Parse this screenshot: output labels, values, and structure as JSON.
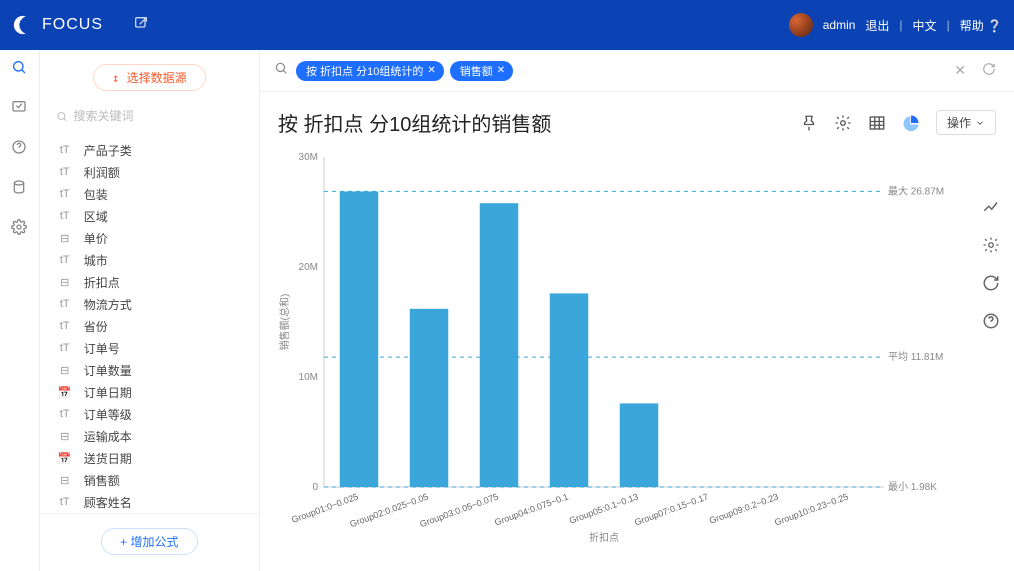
{
  "brand": "FOCUS",
  "top_user": "admin",
  "top_links": {
    "logout": "退出",
    "lang": "中文",
    "help": "帮助"
  },
  "ds_button": "选择数据源",
  "field_search_placeholder": "搜索关键词",
  "add_formula": "增加公式",
  "fields": [
    {
      "type": "tT",
      "label": "产品子类"
    },
    {
      "type": "tT",
      "label": "利润额"
    },
    {
      "type": "tT",
      "label": "包装"
    },
    {
      "type": "tT",
      "label": "区域"
    },
    {
      "type": "Nn",
      "label": "单价"
    },
    {
      "type": "tT",
      "label": "城市"
    },
    {
      "type": "Nn",
      "label": "折扣点"
    },
    {
      "type": "tT",
      "label": "物流方式"
    },
    {
      "type": "tT",
      "label": "省份"
    },
    {
      "type": "tT",
      "label": "订单号"
    },
    {
      "type": "Nn",
      "label": "订单数量"
    },
    {
      "type": "Dt",
      "label": "订单日期"
    },
    {
      "type": "tT",
      "label": "订单等级"
    },
    {
      "type": "Nn",
      "label": "运输成本"
    },
    {
      "type": "Dt",
      "label": "送货日期"
    },
    {
      "type": "Nn",
      "label": "销售额"
    },
    {
      "type": "tT",
      "label": "顾客姓名"
    }
  ],
  "chips": [
    {
      "label": "按 折扣点 分10组统计的"
    },
    {
      "label": "销售额"
    }
  ],
  "title": "按 折扣点 分10组统计的销售额",
  "ops_label": "操作",
  "chart_data": {
    "type": "bar",
    "title": "按 折扣点 分10组统计的销售额",
    "xlabel": "折扣点",
    "ylabel": "销售额(总和)",
    "ylim": [
      0,
      30000000
    ],
    "yticks": [
      {
        "v": 0,
        "label": "0"
      },
      {
        "v": 10000000,
        "label": "10M"
      },
      {
        "v": 20000000,
        "label": "20M"
      },
      {
        "v": 30000000,
        "label": "30M"
      }
    ],
    "categories": [
      "Group01:0~0.025",
      "Group02:0.025~0.05",
      "Group03:0.05~0.075",
      "Group04:0.075~0.1",
      "Group05:0.1~0.13",
      "Group07:0.15~0.17",
      "Group09:0.2~0.23",
      "Group10:0.23~0.25"
    ],
    "values": [
      26870000,
      16200000,
      25800000,
      17600000,
      7600000,
      0,
      0,
      0
    ],
    "reference_lines": [
      {
        "label": "最大 26.87M",
        "value": 26870000
      },
      {
        "label": "平均 11.81M",
        "value": 11810000
      },
      {
        "label": "最小 1.98K",
        "value": 1980
      }
    ]
  }
}
